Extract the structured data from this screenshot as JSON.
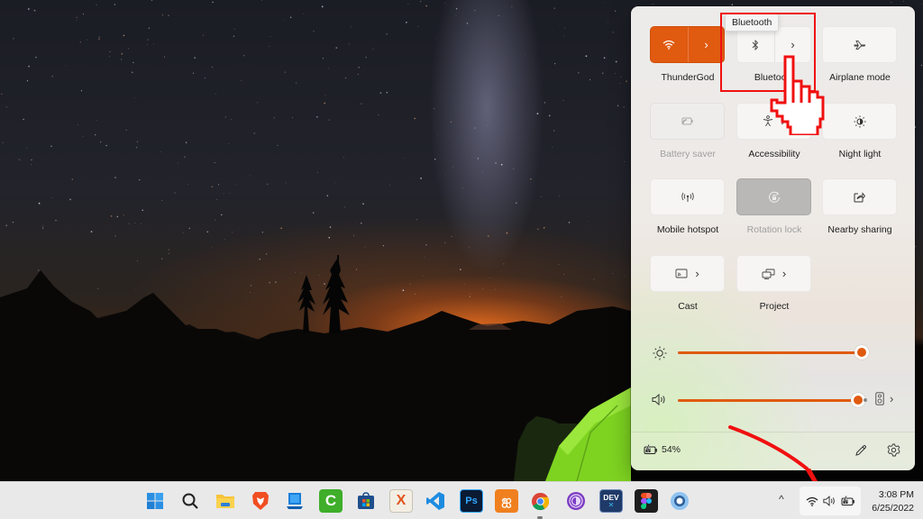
{
  "quick_settings": {
    "tiles": [
      {
        "id": "wifi",
        "label": "ThunderGod",
        "icon": "wifi-icon",
        "state": "on",
        "has_chevron": true
      },
      {
        "id": "bluetooth",
        "label": "Bluetooth",
        "icon": "bluetooth-icon",
        "state": "off",
        "has_chevron": true
      },
      {
        "id": "airplane",
        "label": "Airplane mode",
        "icon": "airplane-icon",
        "state": "off",
        "has_chevron": false
      },
      {
        "id": "battery-saver",
        "label": "Battery saver",
        "icon": "battery-saver-icon",
        "state": "disabled",
        "has_chevron": false
      },
      {
        "id": "accessibility",
        "label": "Accessibility",
        "icon": "accessibility-icon",
        "state": "off",
        "has_chevron": true
      },
      {
        "id": "night-light",
        "label": "Night light",
        "icon": "night-light-icon",
        "state": "off",
        "has_chevron": false
      },
      {
        "id": "mobile-hotspot",
        "label": "Mobile hotspot",
        "icon": "hotspot-icon",
        "state": "off",
        "has_chevron": false
      },
      {
        "id": "rotation-lock",
        "label": "Rotation lock",
        "icon": "rotation-lock-icon",
        "state": "locked",
        "has_chevron": false
      },
      {
        "id": "nearby-sharing",
        "label": "Nearby sharing",
        "icon": "share-icon",
        "state": "off",
        "has_chevron": false
      },
      {
        "id": "cast",
        "label": "Cast",
        "icon": "cast-icon",
        "state": "off",
        "has_chevron": true
      },
      {
        "id": "project",
        "label": "Project",
        "icon": "project-icon",
        "state": "off",
        "has_chevron": true
      }
    ],
    "brightness": {
      "icon": "brightness-icon",
      "value_percent": 100
    },
    "volume": {
      "icon": "speaker-icon",
      "value_percent": 100,
      "output_icon": "speaker-device-icon"
    },
    "battery": {
      "icon": "battery-charging-icon",
      "label": "54%"
    },
    "footer_buttons": [
      "edit-icon",
      "settings-icon"
    ],
    "tooltip": "Bluetooth",
    "chevron": "›",
    "accent": "#e05a10"
  },
  "taskbar": {
    "apps": [
      {
        "name": "start",
        "icon": "windows-start-icon"
      },
      {
        "name": "search",
        "icon": "search-icon"
      },
      {
        "name": "file-explorer",
        "icon": "folder-icon"
      },
      {
        "name": "brave",
        "icon": "brave-icon"
      },
      {
        "name": "remote-desktop",
        "icon": "monitor-icon"
      },
      {
        "name": "camtasia",
        "icon": "camtasia-icon",
        "glyph": "C"
      },
      {
        "name": "microsoft-store",
        "icon": "store-icon"
      },
      {
        "name": "xml-notepad",
        "icon": "xml-icon",
        "glyph": "X"
      },
      {
        "name": "vscode",
        "icon": "vscode-icon"
      },
      {
        "name": "photoshop",
        "icon": "photoshop-icon",
        "glyph": "Ps"
      },
      {
        "name": "xampp",
        "icon": "xampp-icon",
        "glyph": "ஐ"
      },
      {
        "name": "chrome",
        "icon": "chrome-icon",
        "active": true
      },
      {
        "name": "tor-browser",
        "icon": "tor-icon"
      },
      {
        "name": "dev-home",
        "icon": "dev-icon",
        "glyph": "DEV"
      },
      {
        "name": "figma",
        "icon": "figma-icon"
      },
      {
        "name": "app-circle",
        "icon": "circle-app-icon"
      }
    ],
    "tray": {
      "overflow_glyph": "^",
      "icons": [
        "wifi-icon",
        "volume-icon",
        "battery-charging-icon"
      ]
    },
    "clock": {
      "time": "3:08 PM",
      "date": "6/25/2022"
    }
  }
}
